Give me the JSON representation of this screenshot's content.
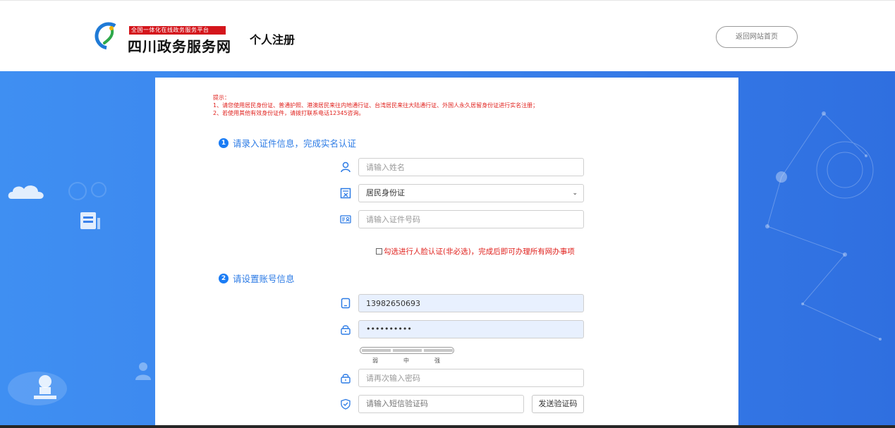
{
  "header": {
    "logo_banner": "全国一体化在线政务服务平台",
    "logo_name": "四川政务服务网",
    "page_title": "个人注册",
    "back_button": "返回网站首页"
  },
  "notice": {
    "title": "提示：",
    "line1": "1、请您使用居民身份证、普通护照、港澳居民来往内地通行证、台湾居民来往大陆通行证、外国人永久居留身份证进行实名注册；",
    "line2": "2、若使用其他有效身份证件，请拨打联系电话12345咨询。"
  },
  "step1": {
    "number": "1",
    "title": "请录入证件信息，完成实名认证",
    "name_placeholder": "请输入姓名",
    "id_type_selected": "居民身份证",
    "id_number_placeholder": "请输入证件号码",
    "face_check_label": "勾选进行人脸认证(非必选)，完成后即可办理所有网办事项"
  },
  "step2": {
    "number": "2",
    "title": "请设置账号信息",
    "phone_value": "13982650693",
    "password_value": "••••••••••",
    "strength_weak": "弱",
    "strength_medium": "中",
    "strength_strong": "强",
    "confirm_placeholder": "请再次输入密码",
    "sms_placeholder": "请输入短信验证码",
    "sms_button": "发送验证码"
  },
  "colors": {
    "accent": "#2c7be5",
    "warning": "#e0211d",
    "brand_red": "#d4161c",
    "background_blue": "#3a82ec"
  },
  "icons": [
    "user-icon",
    "id-type-icon",
    "id-card-icon",
    "phone-icon",
    "lock-icon",
    "lock-icon",
    "shield-check-icon"
  ]
}
